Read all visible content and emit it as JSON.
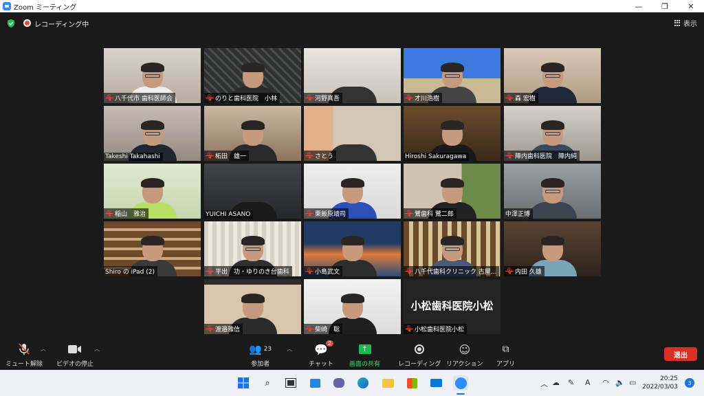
{
  "window": {
    "title": "Zoom ミーティング",
    "minimize": "—",
    "maximize": "❐",
    "close": "✕"
  },
  "meeting_bar": {
    "recording_label": "レコーディング中",
    "view_label": "表示"
  },
  "participants": [
    {
      "name": "八千代市 歯科医師会"
    },
    {
      "name": "のりと歯科医院　小林"
    },
    {
      "name": "河野真吾"
    },
    {
      "name": "才川浩樹"
    },
    {
      "name": "森 宏樹"
    },
    {
      "name": "Takeshi Takahashi"
    },
    {
      "name": "柘田　雄一"
    },
    {
      "name": "さとう"
    },
    {
      "name": "Hiroshi Sakuragawa"
    },
    {
      "name": "陣内歯科医院　陣内純"
    },
    {
      "name": "稲山　雅治"
    },
    {
      "name": "YUICHI ASANO"
    },
    {
      "name": "栗飯原靖司"
    },
    {
      "name": "鷺歯科 鷺二郎"
    },
    {
      "name": "中澤正博"
    },
    {
      "name": "Shiro の iPad (2)"
    },
    {
      "name": "平出　功・ゆりのき台歯科"
    },
    {
      "name": "小島武文"
    },
    {
      "name": "八千代歯科クリニック 古屋..."
    },
    {
      "name": "内田 久雄"
    },
    {
      "name": "渡邉雅信"
    },
    {
      "name": "柴崎　聡"
    },
    {
      "name": "小松歯科医院小松",
      "display": "小松歯科医院小松"
    }
  ],
  "toolbar": {
    "mute_label": "ミュート解除",
    "video_label": "ビデオの停止",
    "participants_label": "参加者",
    "participants_count": "23",
    "chat_label": "チャット",
    "chat_badge": "2",
    "share_label": "画面の共有",
    "record_label": "レコーディング",
    "reactions_label": "リアクション",
    "apps_label": "アプリ",
    "leave_label": "退出"
  },
  "taskbar": {
    "time": "20:25",
    "date": "2022/03/03",
    "notifications": "3",
    "ime": "A"
  },
  "colors": {
    "active_speaker": "#ffeb3b",
    "leave": "#d93025",
    "share": "#1db954",
    "muted": "#e84c3d"
  }
}
